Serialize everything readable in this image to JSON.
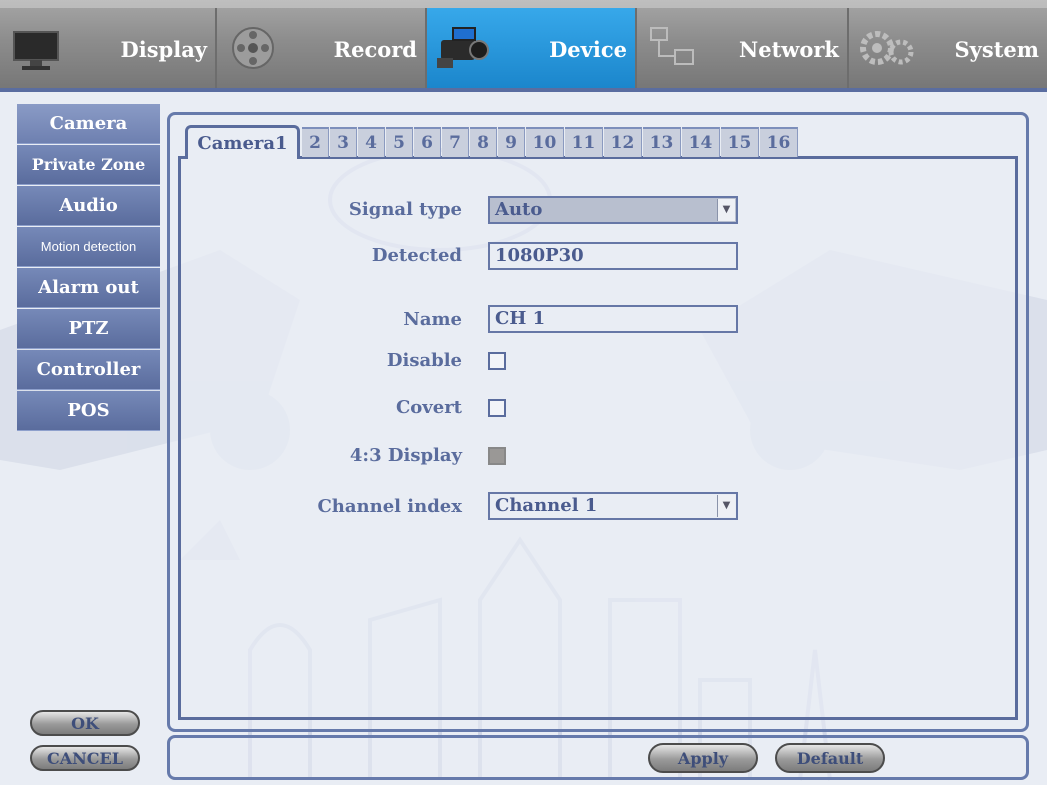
{
  "menu": {
    "items": [
      {
        "label": "Display",
        "icon": "monitor-icon",
        "active": false
      },
      {
        "label": "Record",
        "icon": "film-reel-icon",
        "active": false
      },
      {
        "label": "Device",
        "icon": "camcorder-icon",
        "active": true
      },
      {
        "label": "Network",
        "icon": "network-icon",
        "active": false
      },
      {
        "label": "System",
        "icon": "gears-icon",
        "active": false
      }
    ]
  },
  "sidebar": {
    "items": [
      {
        "label": "Camera",
        "active": true
      },
      {
        "label": "Private Zone"
      },
      {
        "label": "Audio"
      },
      {
        "label": "Motion detection"
      },
      {
        "label": "Alarm out"
      },
      {
        "label": "PTZ"
      },
      {
        "label": "Controller"
      },
      {
        "label": "POS"
      }
    ],
    "ok_label": "OK",
    "cancel_label": "CANCEL"
  },
  "tabs": [
    "Camera1",
    "2",
    "3",
    "4",
    "5",
    "6",
    "7",
    "8",
    "9",
    "10",
    "11",
    "12",
    "13",
    "14",
    "15",
    "16"
  ],
  "active_tab": "Camera1",
  "form": {
    "signal_type": {
      "label": "Signal type",
      "value": "Auto"
    },
    "detected": {
      "label": "Detected",
      "value": "1080P30"
    },
    "name": {
      "label": "Name",
      "value": "CH 1"
    },
    "disable": {
      "label": "Disable",
      "checked": false
    },
    "covert": {
      "label": "Covert",
      "checked": false
    },
    "display43": {
      "label": "4:3 Display",
      "checked": false,
      "enabled": false
    },
    "channel_index": {
      "label": "Channel index",
      "value": "Channel 1"
    }
  },
  "footer": {
    "apply_label": "Apply",
    "default_label": "Default"
  },
  "colors": {
    "accent_blue": "#1b86cc",
    "panel_border": "#5a6c9d",
    "label_text": "#5a6c9d",
    "background": "#e9edf4"
  }
}
